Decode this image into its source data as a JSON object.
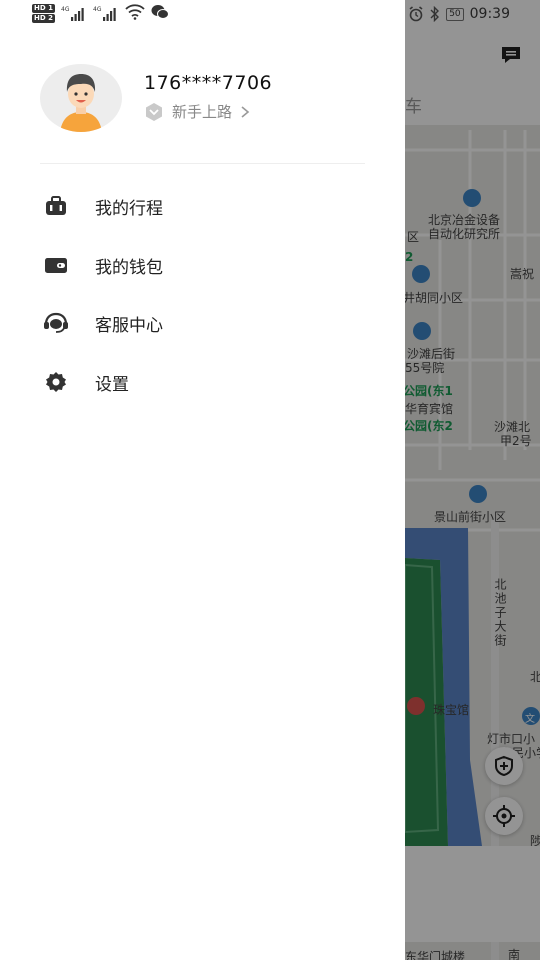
{
  "status_bar": {
    "hd1": "HD 1",
    "hd2": "HD 2",
    "net1": "4G",
    "net2": "4G",
    "battery": "50",
    "time": "09:39"
  },
  "profile": {
    "phone": "176****7706",
    "level": "新手上路"
  },
  "menu": [
    {
      "label": "我的行程",
      "icon": "suitcase-icon"
    },
    {
      "label": "我的钱包",
      "icon": "wallet-icon"
    },
    {
      "label": "客服中心",
      "icon": "headset-icon"
    },
    {
      "label": "设置",
      "icon": "gear-icon"
    }
  ],
  "map": {
    "tab_partial": "车",
    "labels": [
      "北京冶金设备",
      "自动化研究所",
      "区",
      "2",
      "嵩祝",
      "井胡同小区",
      "沙滩后街",
      "55号院",
      "公园(东1",
      "华育宾馆",
      "公园(东2",
      "沙滩北",
      "甲2号",
      "景山前街小区",
      "北池子大街",
      "北",
      "珠宝馆",
      "灯市口小",
      "人民小学",
      "陟",
      "东华门城楼",
      "南",
      "文"
    ]
  },
  "colors": {
    "accent_green": "#1e9e56",
    "poi_blue": "#3d86c6",
    "overlay": "rgba(0,0,0,0.42)"
  }
}
